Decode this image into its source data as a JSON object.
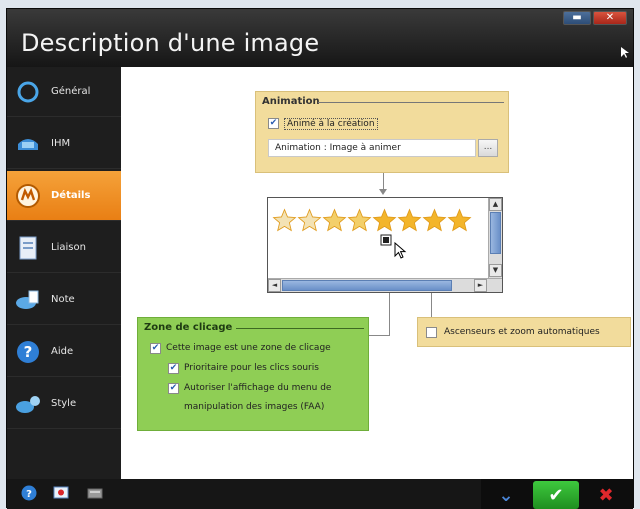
{
  "window": {
    "title": "Description d'une image",
    "controls": [
      "minimize",
      "close"
    ]
  },
  "sidebar": {
    "items": [
      {
        "label": "Général",
        "icon": "ring-icon",
        "active": false
      },
      {
        "label": "IHM",
        "icon": "window-icon",
        "active": false
      },
      {
        "label": "Détails",
        "icon": "details-icon",
        "active": true
      },
      {
        "label": "Liaison",
        "icon": "document-icon",
        "active": false
      },
      {
        "label": "Note",
        "icon": "note-icon",
        "active": false
      },
      {
        "label": "Aide",
        "icon": "help-icon",
        "active": false
      },
      {
        "label": "Style",
        "icon": "style-icon",
        "active": false
      }
    ]
  },
  "animation": {
    "title": "Animation",
    "checkbox_label": "Animé à la création",
    "checked": true,
    "field_value": "Animation : Image à animer",
    "browse_label": "..."
  },
  "preview": {
    "stars_count": 8,
    "scroll_arrows": {
      "up": "▲",
      "down": "▼",
      "left": "◄",
      "right": "►"
    }
  },
  "zone": {
    "title": "Zone de clicage",
    "options": [
      {
        "label": "Cette image est une zone de clicage",
        "checked": true
      },
      {
        "label": "Prioritaire pour les clics souris",
        "checked": true
      },
      {
        "label": "Autoriser l'affichage du menu de",
        "label2": "manipulation des images (FAA)",
        "checked": true
      }
    ]
  },
  "scroll_option": {
    "label": "Ascenseurs et zoom automatiques",
    "checked": false
  },
  "footer": {
    "buttons": [
      "down",
      "ok",
      "cancel"
    ]
  },
  "colors": {
    "accent": "#e98414",
    "animation_panel": "#f2dc9c",
    "zone_panel": "#8fce55",
    "ok_green": "#2fae2f",
    "cancel_red": "#d9262a"
  }
}
